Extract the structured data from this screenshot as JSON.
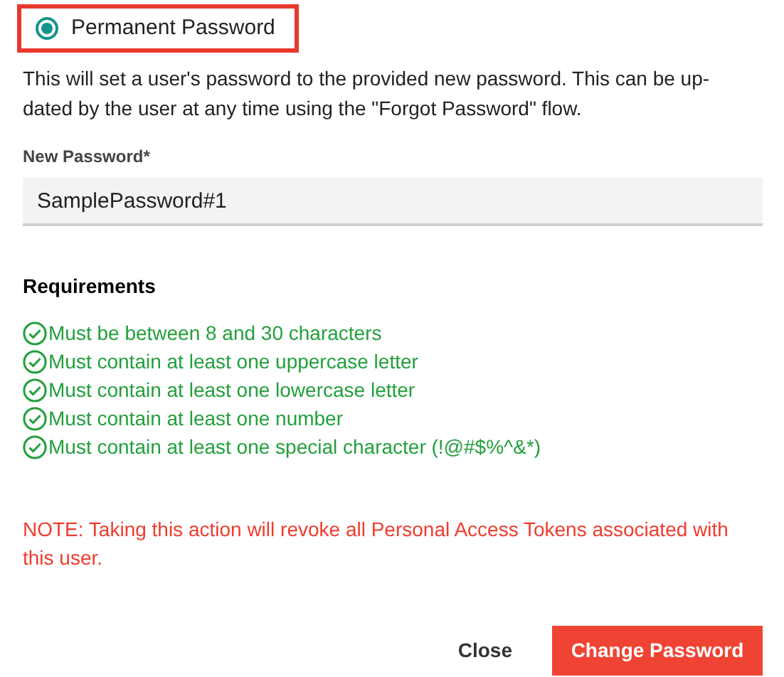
{
  "option": {
    "label": "Permanent Password",
    "selected": true
  },
  "description_lines": [
    "This will set a user's password to the provided new password. This can be up-",
    "dated by the user at any time using the \"Forgot Password\" flow."
  ],
  "new_password": {
    "label": "New Password*",
    "value": "SamplePassword#1"
  },
  "requirements": {
    "title": "Requirements",
    "items": [
      {
        "text": "Must be between 8 and 30 characters",
        "met": true
      },
      {
        "text": "Must contain at least one uppercase letter",
        "met": true
      },
      {
        "text": "Must contain at least one lowercase letter",
        "met": true
      },
      {
        "text": "Must contain at least one number",
        "met": true
      },
      {
        "text": "Must contain at least one special character (!@#$%^&*)",
        "met": true
      }
    ]
  },
  "note": "NOTE: Taking this action will revoke all Personal Access Tokens associated with this user.",
  "buttons": {
    "close": "Close",
    "submit": "Change Password"
  }
}
